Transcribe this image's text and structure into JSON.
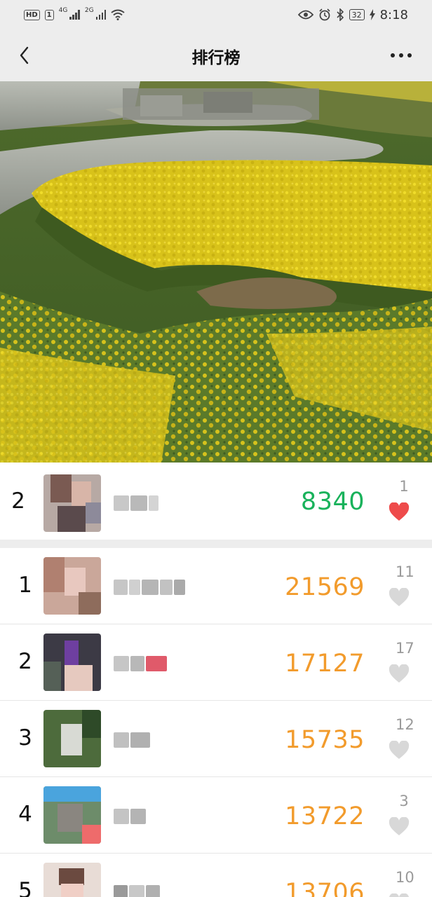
{
  "status_bar": {
    "hd": "HD",
    "sim": "1",
    "net1": "4G",
    "net2": "2G",
    "battery": "32",
    "time": "8:18"
  },
  "nav": {
    "title": "排行榜"
  },
  "cover": {
    "image": "rapeseed-field-photo"
  },
  "my_rank": {
    "rank": "2",
    "steps": "8340",
    "likes": "1",
    "liked": true
  },
  "rankings": [
    {
      "rank": "1",
      "steps": "21569",
      "likes": "11"
    },
    {
      "rank": "2",
      "steps": "17127",
      "likes": "17"
    },
    {
      "rank": "3",
      "steps": "15735",
      "likes": "12"
    },
    {
      "rank": "4",
      "steps": "13722",
      "likes": "3"
    },
    {
      "rank": "5",
      "steps": "13706",
      "likes": "10"
    }
  ],
  "colors": {
    "my_steps": "#19b25b",
    "steps": "#f29b2c",
    "heart_active": "#ee4b4b",
    "heart_inactive": "#d8d8d8"
  }
}
